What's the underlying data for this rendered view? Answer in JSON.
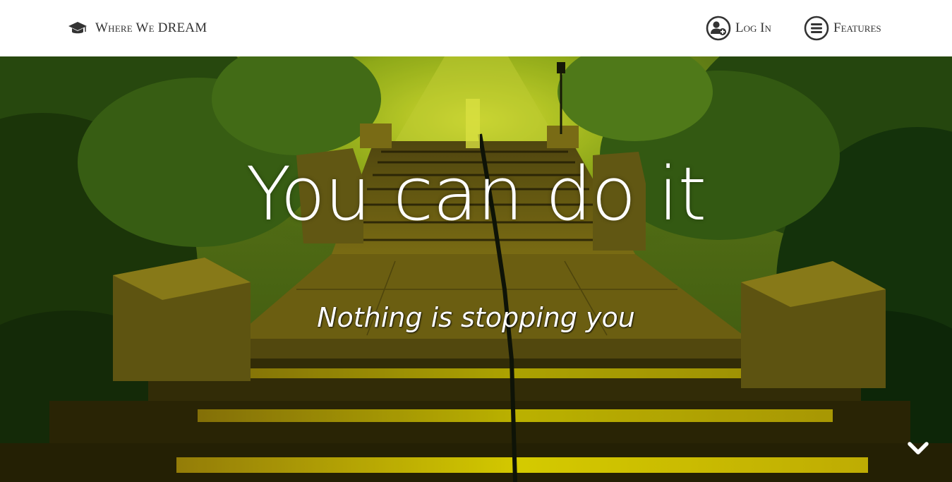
{
  "navbar": {
    "brand": {
      "text": "Where We DREAM",
      "icon": "graduation-cap-icon"
    },
    "links": [
      {
        "label": "Log In",
        "icon": "user-plus-icon"
      },
      {
        "label": "Features",
        "icon": "menu-icon"
      }
    ]
  },
  "hero": {
    "headline": "You can do it",
    "subline": "Nothing is stopping you",
    "scroll_icon": "chevron-down-icon",
    "background": "garden-staircase-photo"
  },
  "colors": {
    "nav_background": "#ffffff",
    "nav_text": "#333333",
    "hero_text": "#ffffff",
    "foliage": "#2f5a14",
    "stone": "#a8951f",
    "highlight": "#f2e600"
  }
}
